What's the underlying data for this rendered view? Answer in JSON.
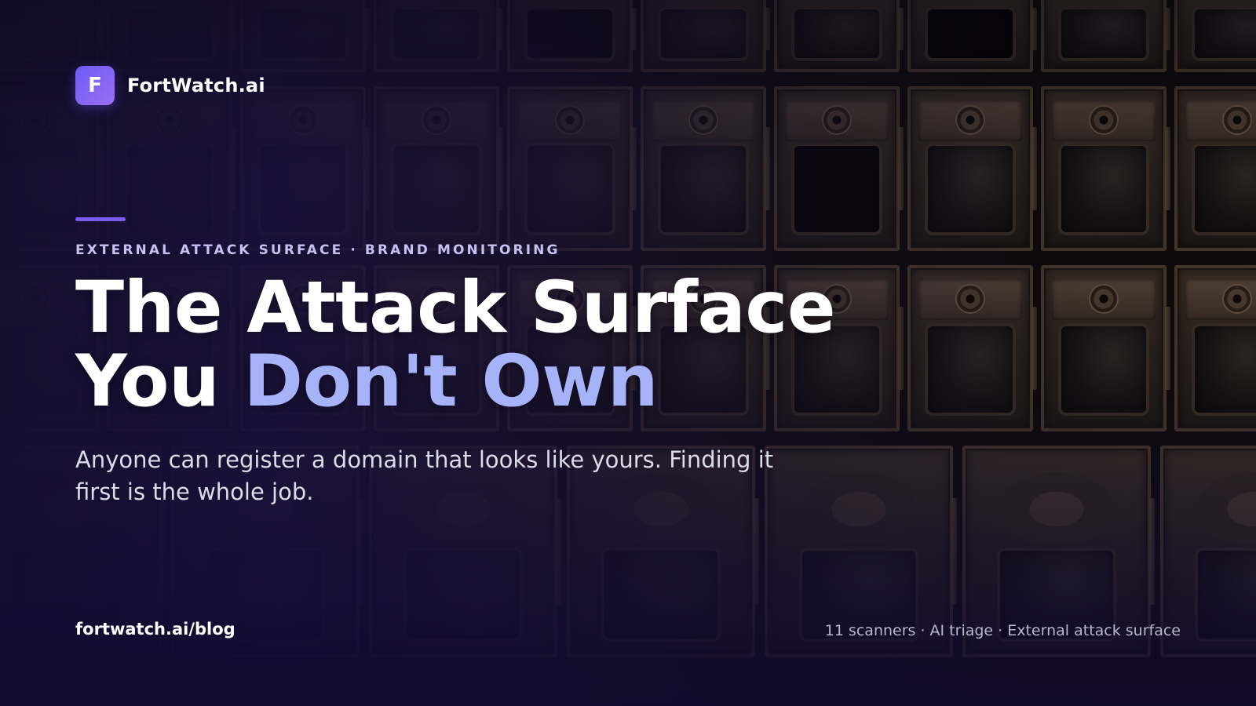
{
  "brand": {
    "logo_letter": "F",
    "name": "FortWatch.ai",
    "accent_color": "#7b5cf0"
  },
  "hero": {
    "eyebrow": "EXTERNAL ATTACK SURFACE · BRAND MONITORING",
    "headline_line1": "The Attack Surface",
    "headline_line2_plain": "You ",
    "headline_line2_highlight": "Don't Own",
    "highlight_color": "#a6b3f8",
    "subtitle": "Anyone can register a domain that looks like yours. Finding it first is the whole job."
  },
  "footer": {
    "url": "fortwatch.ai/blog",
    "tags": "11 scanners · AI triage · External attack surface"
  },
  "background": {
    "image_subject": "vintage-po-box-doors",
    "icon": "po-box-wall"
  }
}
